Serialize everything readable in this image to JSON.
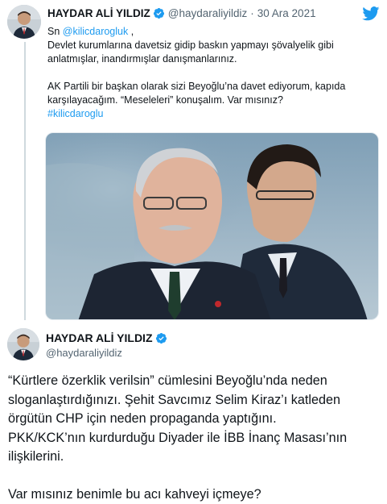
{
  "tweet1": {
    "author_name": "HAYDAR ALİ YILDIZ",
    "handle": "@haydaraliyildiz",
    "separator": "·",
    "date": "30 Ara 2021",
    "mention_prefix": "Sn ",
    "mention": "@kilicdarogluk",
    "mention_suffix": " ,",
    "para1": "Devlet kurumlarına davetsiz gidip baskın yapmayı şövalyelik gibi anlatmışlar, inandırmışlar danışmanlarınız.",
    "para2": "AK Partili bir başkan olarak sizi Beyoğlu’na davet ediyorum, kapıda karşılayacağım. “Meseleleri” konuşalım. Var mısınız?",
    "hashtag": "#kilicdaroglu"
  },
  "tweet2": {
    "author_name": "HAYDAR ALİ YILDIZ",
    "handle": "@haydaraliyildiz",
    "para1": "“Kürtlere özerklik verilsin” cümlesini Beyoğlu’nda neden sloganlaştırdığınızı. Şehit Savcımız Selim Kiraz’ı katleden örgütün CHP için neden propaganda yaptığını.",
    "para2": "PKK/KCK’nın kurdurduğu Diyader ile İBB İnanç Masası’nın ilişkilerini.",
    "para3": "Var mısınız benimle bu acı kahveyi içmeye?"
  },
  "icons": {
    "brand": "twitter-bird-icon",
    "verified": "verified-badge-icon"
  },
  "colors": {
    "link": "#1d9bf0",
    "secondary_text": "#536471",
    "primary_text": "#0f1419",
    "thread_line": "#cfd9de"
  }
}
